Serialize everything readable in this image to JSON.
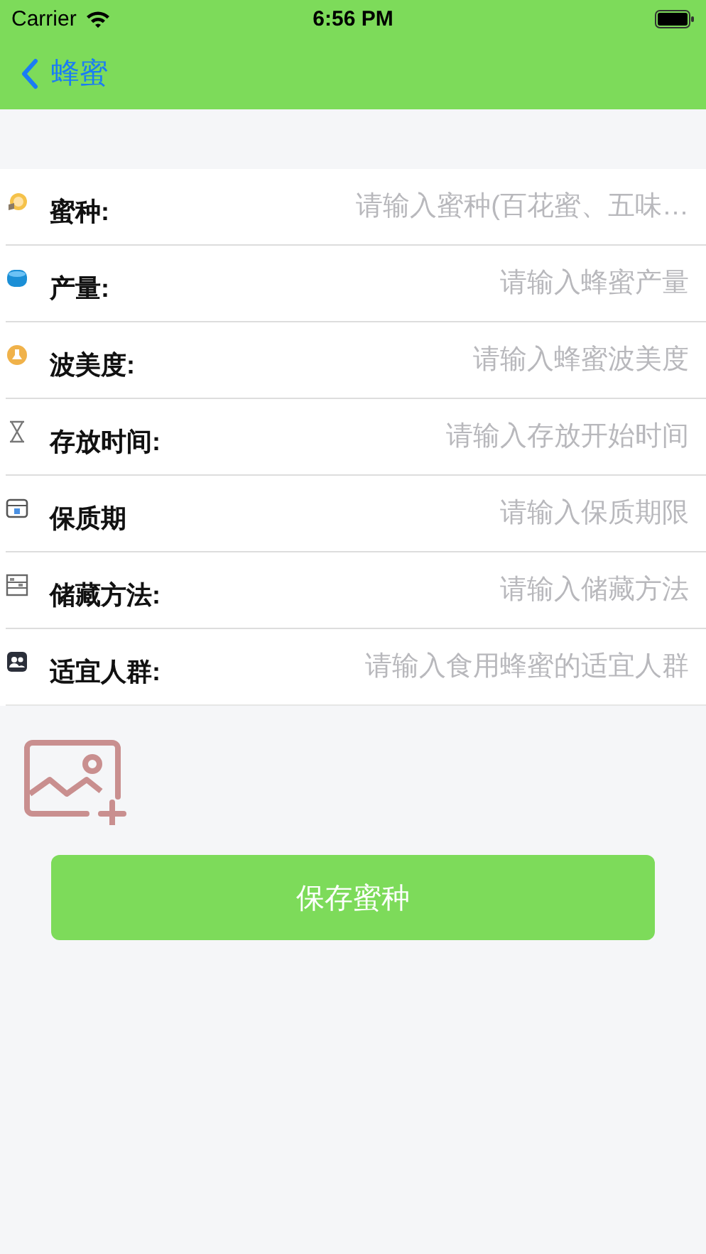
{
  "status_bar": {
    "carrier": "Carrier",
    "time": "6:56 PM"
  },
  "nav": {
    "back_label": "蜂蜜"
  },
  "fields": [
    {
      "label": "蜜种:",
      "placeholder": "请输入蜜种(百花蜜、五味…"
    },
    {
      "label": "产量:",
      "placeholder": "请输入蜂蜜产量"
    },
    {
      "label": "波美度:",
      "placeholder": "请输入蜂蜜波美度"
    },
    {
      "label": "存放时间:",
      "placeholder": "请输入存放开始时间"
    },
    {
      "label": "保质期",
      "placeholder": "请输入保质期限"
    },
    {
      "label": "储藏方法:",
      "placeholder": "请输入储藏方法"
    },
    {
      "label": "适宜人群:",
      "placeholder": "请输入食用蜂蜜的适宜人群"
    }
  ],
  "save_button": "保存蜜种"
}
